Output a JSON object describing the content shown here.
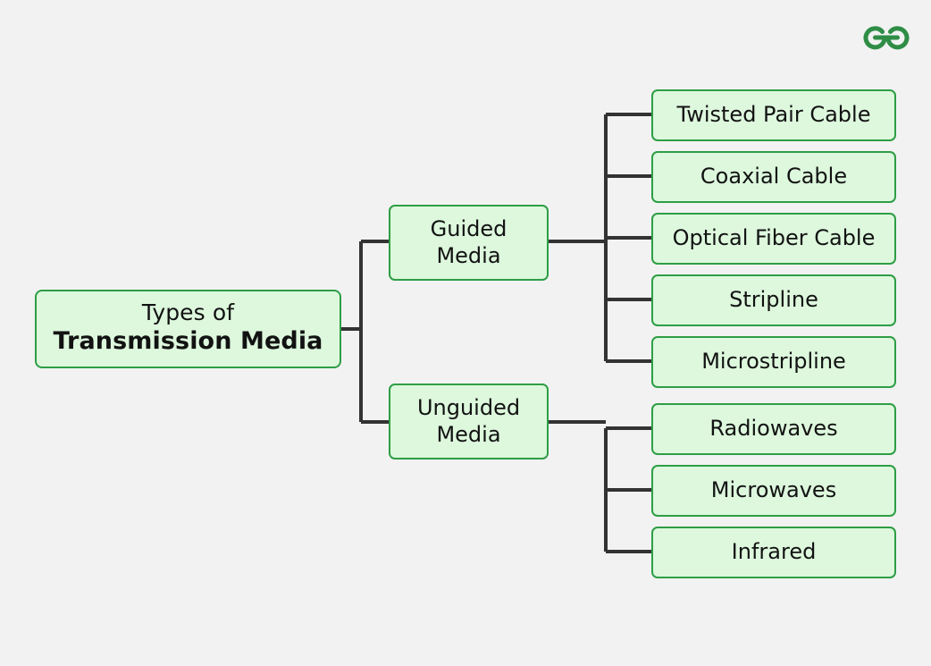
{
  "page": {
    "background_color": "#f2f2f2",
    "title": "Types of Transmission Media"
  },
  "logo": {
    "name": "geeksforgeeks-logo",
    "color": "#2f8d46",
    "alt_text": "GeeksforGeeks"
  },
  "colors": {
    "node_fill": "#ddf8dd",
    "node_border": "#2e9e45",
    "connector": "#333333",
    "text": "#121212"
  },
  "root": {
    "line1": "Types of",
    "line2": "Transmission Media"
  },
  "branches": [
    {
      "id": "guided",
      "line1": "Guided",
      "line2": "Media",
      "full_label": "Guided Media",
      "children": [
        "Twisted Pair Cable",
        "Coaxial Cable",
        "Optical Fiber Cable",
        "Stripline",
        "Microstripline"
      ]
    },
    {
      "id": "unguided",
      "line1": "Unguided",
      "line2": "Media",
      "full_label": "Unguided Media",
      "children": [
        "Radiowaves",
        "Microwaves",
        "Infrared"
      ]
    }
  ],
  "leaves": [
    "Twisted Pair Cable",
    "Coaxial Cable",
    "Optical Fiber Cable",
    "Stripline",
    "Microstripline",
    "Radiowaves",
    "Microwaves",
    "Infrared"
  ],
  "chart_data": {
    "type": "diagram",
    "diagram_kind": "hierarchy-tree",
    "orientation": "left-to-right",
    "title": "Types of Transmission Media",
    "levels": 3,
    "node_count": 11,
    "tree": {
      "label": "Types of Transmission Media",
      "children": [
        {
          "label": "Guided Media",
          "children": [
            {
              "label": "Twisted Pair Cable"
            },
            {
              "label": "Coaxial Cable"
            },
            {
              "label": "Optical Fiber Cable"
            },
            {
              "label": "Stripline"
            },
            {
              "label": "Microstripline"
            }
          ]
        },
        {
          "label": "Unguided Media",
          "children": [
            {
              "label": "Radiowaves"
            },
            {
              "label": "Microwaves"
            },
            {
              "label": "Infrared"
            }
          ]
        }
      ]
    }
  }
}
